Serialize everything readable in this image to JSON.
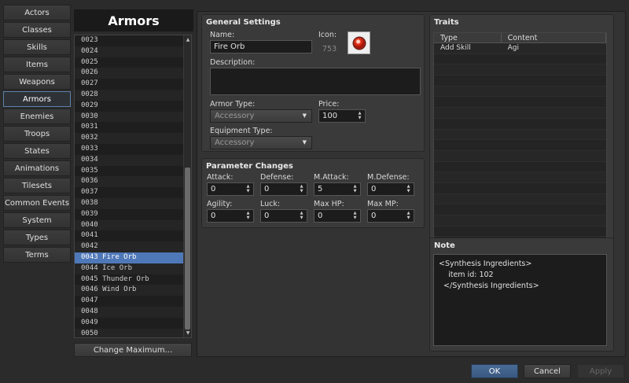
{
  "tabs": [
    {
      "label": "Actors",
      "active": false
    },
    {
      "label": "Classes",
      "active": false
    },
    {
      "label": "Skills",
      "active": false
    },
    {
      "label": "Items",
      "active": false
    },
    {
      "label": "Weapons",
      "active": false
    },
    {
      "label": "Armors",
      "active": true
    },
    {
      "label": "Enemies",
      "active": false
    },
    {
      "label": "Troops",
      "active": false
    },
    {
      "label": "States",
      "active": false
    },
    {
      "label": "Animations",
      "active": false
    },
    {
      "label": "Tilesets",
      "active": false
    },
    {
      "label": "Common Events",
      "active": false
    },
    {
      "label": "System",
      "active": false
    },
    {
      "label": "Types",
      "active": false
    },
    {
      "label": "Terms",
      "active": false
    }
  ],
  "list": {
    "title": "Armors",
    "change_maximum_label": "Change Maximum...",
    "selected": "0043 Fire Orb",
    "items": [
      "0023",
      "0024",
      "0025",
      "0026",
      "0027",
      "0028",
      "0029",
      "0030",
      "0031",
      "0032",
      "0033",
      "0034",
      "0035",
      "0036",
      "0037",
      "0038",
      "0039",
      "0040",
      "0041",
      "0042",
      "0043 Fire Orb",
      "0044 Ice Orb",
      "0045 Thunder Orb",
      "0046 Wind Orb",
      "0047",
      "0048",
      "0049",
      "0050"
    ]
  },
  "general": {
    "title": "General Settings",
    "name_label": "Name:",
    "name_value": "Fire Orb",
    "icon_label": "Icon:",
    "icon_index": "753",
    "icon_name": "red-orb-icon",
    "description_label": "Description:",
    "description_value": "",
    "armor_type_label": "Armor Type:",
    "armor_type_value": "Accessory",
    "price_label": "Price:",
    "price_value": "100",
    "equipment_type_label": "Equipment Type:",
    "equipment_type_value": "Accessory"
  },
  "params": {
    "title": "Parameter Changes",
    "fields": [
      {
        "label": "Attack:",
        "value": "0"
      },
      {
        "label": "Defense:",
        "value": "0"
      },
      {
        "label": "M.Attack:",
        "value": "5"
      },
      {
        "label": "M.Defense:",
        "value": "0"
      },
      {
        "label": "Agility:",
        "value": "0"
      },
      {
        "label": "Luck:",
        "value": "0"
      },
      {
        "label": "Max HP:",
        "value": "0"
      },
      {
        "label": "Max MP:",
        "value": "0"
      }
    ]
  },
  "traits": {
    "title": "Traits",
    "col_type": "Type",
    "col_content": "Content",
    "rows": [
      {
        "type": "Add Skill",
        "content": "Agi"
      }
    ]
  },
  "note": {
    "title": "Note",
    "text": "<Synthesis Ingredients>\n    item id: 102\n  </Synthesis Ingredients>"
  },
  "buttons": {
    "ok": "OK",
    "cancel": "Cancel",
    "apply": "Apply"
  },
  "colors": {
    "selection": "#4f78b8",
    "ok_button": "#486b95",
    "active_tab_border": "#5d7fa8"
  }
}
